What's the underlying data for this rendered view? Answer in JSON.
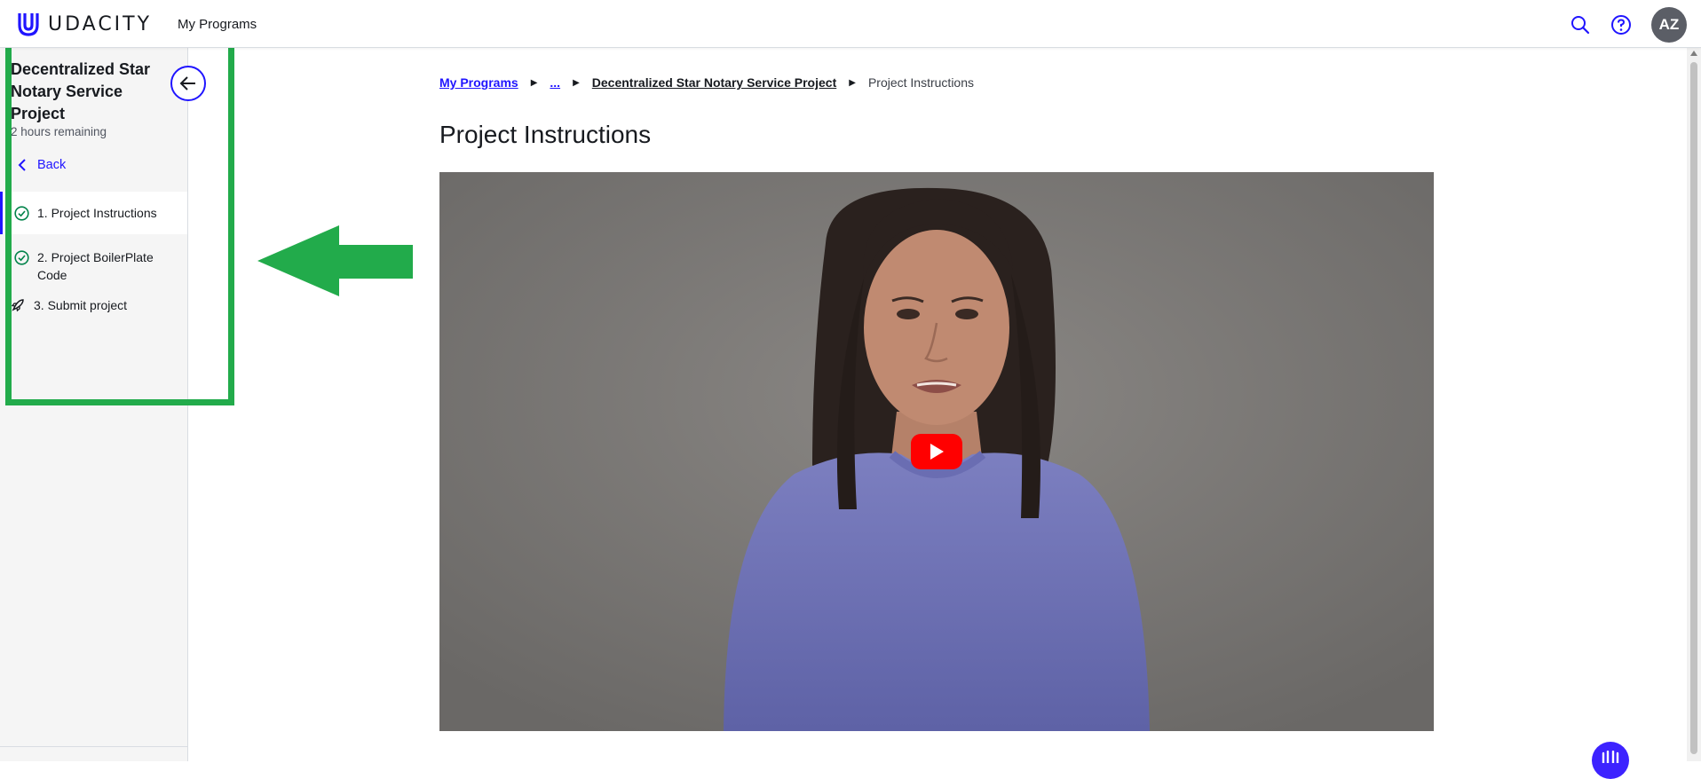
{
  "header": {
    "logo_text": "UDACITY",
    "nav_link": "My Programs",
    "avatar_initials": "AZ",
    "brand_color": "#2015ff"
  },
  "sidebar": {
    "title": "Decentralized Star Notary Service Project",
    "remaining": "2 hours remaining",
    "back_label": "Back",
    "items": [
      {
        "label": "1. Project Instructions",
        "icon": "check-circle-icon",
        "status": "completed",
        "active": true
      },
      {
        "label": "2. Project BoilerPlate Code",
        "icon": "check-circle-icon",
        "status": "completed",
        "active": false
      },
      {
        "label": "3. Submit project",
        "icon": "rocket-icon",
        "status": "pending",
        "active": false
      }
    ]
  },
  "breadcrumb": {
    "items": [
      {
        "label": "My Programs",
        "type": "link"
      },
      {
        "label": "...",
        "type": "link"
      },
      {
        "label": "Decentralized Star Notary Service Project",
        "type": "link"
      },
      {
        "label": "Project Instructions",
        "type": "current"
      }
    ]
  },
  "main": {
    "title": "Project Instructions",
    "video": {
      "provider": "YouTube",
      "play_icon": "youtube-play-icon"
    }
  },
  "annotation": {
    "highlight_color": "#22ab4b",
    "arrow": "left-arrow"
  }
}
